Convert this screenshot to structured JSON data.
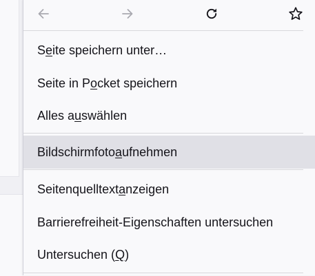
{
  "navigation": {
    "back_icon": "arrow-left-icon",
    "forward_icon": "arrow-right-icon",
    "reload_icon": "reload-icon",
    "bookmark_icon": "star-icon"
  },
  "menu": {
    "save_page": {
      "before": "S",
      "key": "e",
      "after": "ite speichern unter…"
    },
    "save_pocket": {
      "before": "Seite in P",
      "key": "o",
      "after": "cket speichern"
    },
    "select_all": {
      "before": "Alles a",
      "key": "u",
      "after": "swählen"
    },
    "screenshot": {
      "before": "Bildschirmfoto ",
      "key": "a",
      "after": "ufnehmen"
    },
    "view_source": {
      "before": "Seitenquelltext ",
      "key": "a",
      "after": "nzeigen"
    },
    "accessibility": {
      "label": "Barrierefreiheit-Eigenschaften untersuchen"
    },
    "inspect": {
      "before": "Untersuchen (",
      "key": "Q",
      "after": ")"
    }
  },
  "colors": {
    "menu_background": "#f9f9fb",
    "hover_background": "#e0e0e6",
    "separator": "#d7d7db",
    "text": "#15141a",
    "disabled_icon": "#a9a9b0",
    "icon": "#15141a"
  }
}
